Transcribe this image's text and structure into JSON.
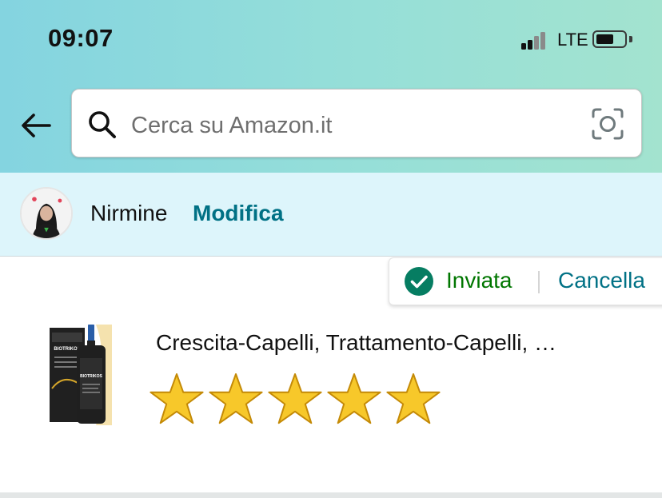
{
  "status_bar": {
    "time": "09:07",
    "network": "LTE",
    "battery_level": 0.55
  },
  "header": {
    "back_icon": "arrow-left-icon",
    "search": {
      "placeholder": "Cerca su Amazon.it",
      "value": ""
    },
    "search_icon": "search-icon",
    "camera_icon": "camera-scan-icon"
  },
  "profile": {
    "name": "Nirmine",
    "edit_label": "Modifica"
  },
  "review_status": {
    "status_label": "Inviata",
    "cancel_label": "Cancella",
    "status_color": "#007600",
    "link_color": "#007185"
  },
  "product": {
    "title": "Crescita-Capelli, Trattamento-Capelli, …",
    "packaging_text": "BIOTRIKOS",
    "rating": 5,
    "max_rating": 5,
    "star_color": "#f7c82a"
  }
}
